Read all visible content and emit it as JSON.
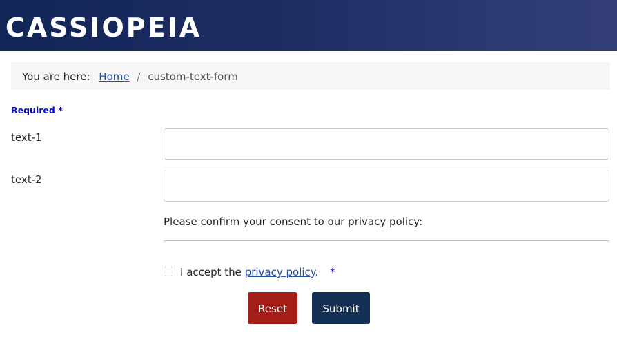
{
  "header": {
    "brand": "CASSIOPEIA"
  },
  "breadcrumb": {
    "prefix": "You are here:",
    "home": "Home",
    "separator": "/",
    "current": "custom-text-form"
  },
  "form": {
    "required_label": "Required",
    "required_mark": "*",
    "fields": [
      {
        "label": "text-1",
        "value": ""
      },
      {
        "label": "text-2",
        "value": ""
      }
    ],
    "consent_text": "Please confirm your consent to our privacy policy:",
    "accept_prefix": "I accept the",
    "privacy_link": "privacy policy",
    "accept_suffix": ".",
    "accept_required_mark": "*",
    "accept_checked": false
  },
  "buttons": {
    "reset": "Reset",
    "submit": "Submit"
  },
  "colors": {
    "header_gradient_start": "#122657",
    "header_gradient_end": "#343e76",
    "link": "#224faa",
    "required": "#0a0ad7",
    "reset_button": "#a51f18",
    "submit_button": "#132f53"
  }
}
